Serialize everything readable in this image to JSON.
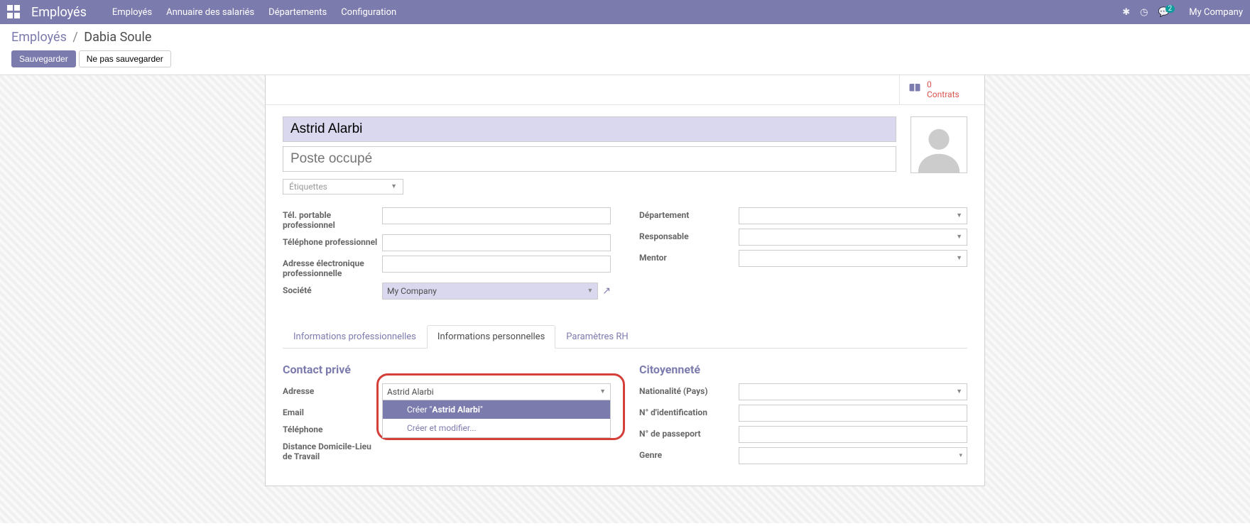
{
  "navbar": {
    "title": "Employés",
    "menu": [
      "Employés",
      "Annuaire des salariés",
      "Départements",
      "Configuration"
    ],
    "company": "My Company",
    "msg_badge": "2"
  },
  "breadcrumb": {
    "root": "Employés",
    "sep": "/",
    "current": "Dabia Soule"
  },
  "buttons": {
    "save": "Sauvegarder",
    "discard": "Ne pas sauvegarder"
  },
  "stat": {
    "count": "0",
    "label": "Contrats"
  },
  "form": {
    "name_value": "Astrid Alarbi",
    "job_placeholder": "Poste occupé",
    "tags_placeholder": "Étiquettes"
  },
  "fields_left": {
    "mobile": "Tél. portable professionnel",
    "phone": "Téléphone professionnel",
    "email": "Adresse électronique professionnelle",
    "company": "Société",
    "company_value": "My Company"
  },
  "fields_right": {
    "department": "Département",
    "manager": "Responsable",
    "mentor": "Mentor"
  },
  "tabs": {
    "pro": "Informations professionnelles",
    "perso": "Informations personnelles",
    "hr": "Paramètres RH"
  },
  "section_private": {
    "title": "Contact privé",
    "address": "Adresse",
    "address_value": "Astrid Alarbi",
    "email": "Email",
    "phone": "Téléphone",
    "distance": "Distance Domicile-Lieu de Travail"
  },
  "section_citizen": {
    "title": "Citoyenneté",
    "nationality": "Nationalité (Pays)",
    "id_number": "N° d'identification",
    "passport": "N° de passeport",
    "gender": "Genre"
  },
  "dropdown": {
    "create_prefix": "Créer \"",
    "create_value": "Astrid Alarbi",
    "create_suffix": "\"",
    "create_edit": "Créer et modifier..."
  }
}
